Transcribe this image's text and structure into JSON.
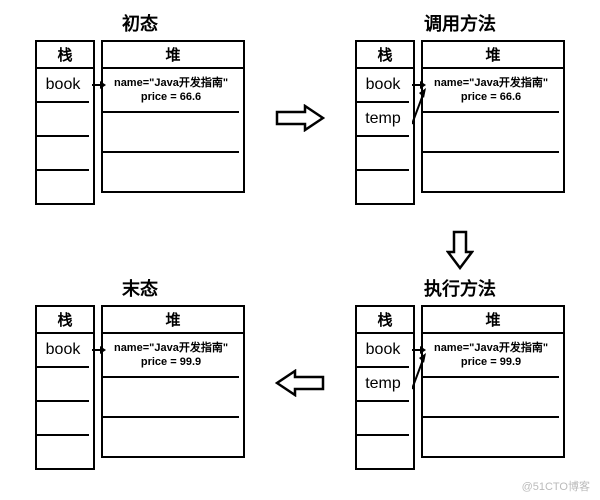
{
  "states": {
    "initial": {
      "title": "初态",
      "stack_label": "栈",
      "heap_label": "堆",
      "stack": [
        "book",
        "",
        "",
        ""
      ],
      "heap": {
        "name_line": "name=\"Java开发指南\"",
        "price_line": "price = 66.6"
      }
    },
    "invoke": {
      "title": "调用方法",
      "stack_label": "栈",
      "heap_label": "堆",
      "stack": [
        "book",
        "temp",
        "",
        ""
      ],
      "heap": {
        "name_line": "name=\"Java开发指南\"",
        "price_line": "price = 66.6"
      }
    },
    "execute": {
      "title": "执行方法",
      "stack_label": "栈",
      "heap_label": "堆",
      "stack": [
        "book",
        "temp",
        "",
        ""
      ],
      "heap": {
        "name_line": "name=\"Java开发指南\"",
        "price_line": "price = 99.9"
      }
    },
    "final": {
      "title": "末态",
      "stack_label": "栈",
      "heap_label": "堆",
      "stack": [
        "book",
        "",
        "",
        ""
      ],
      "heap": {
        "name_line": "name=\"Java开发指南\"",
        "price_line": "price = 99.9"
      }
    }
  },
  "watermark": "@51CTO博客"
}
